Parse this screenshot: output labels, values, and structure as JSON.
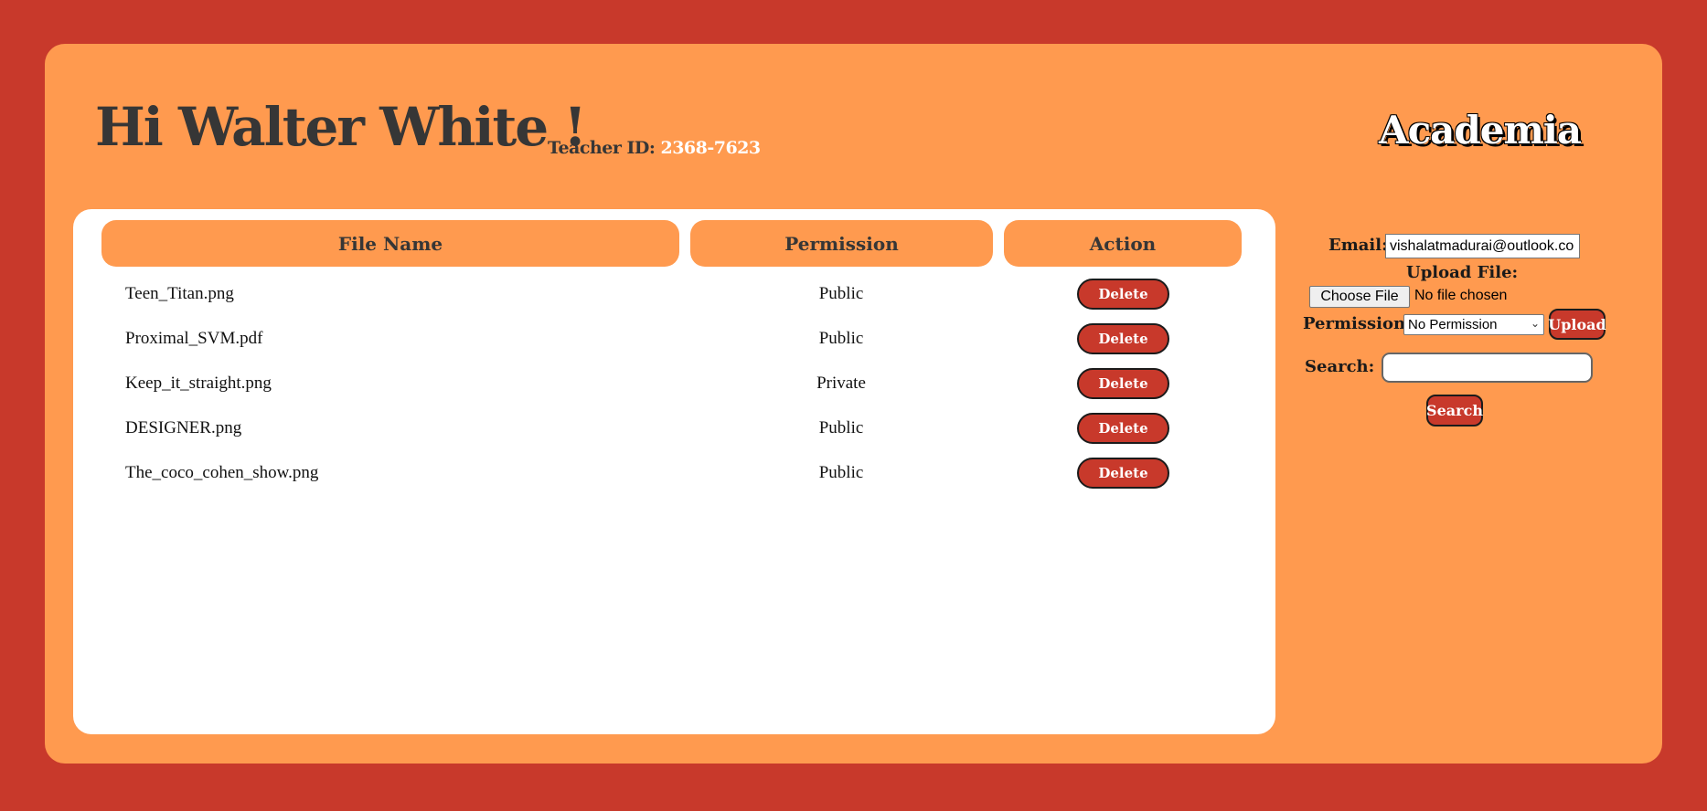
{
  "header": {
    "greeting": "Hi Walter White !",
    "teacher_label": "Teacher ID:",
    "teacher_id": "2368-7623",
    "brand": "Academia"
  },
  "table": {
    "columns": [
      "File Name",
      "Permission",
      "Action"
    ],
    "rows": [
      {
        "file_name": "Teen_Titan.png",
        "permission": "Public",
        "action": "Delete"
      },
      {
        "file_name": "Proximal_SVM.pdf",
        "permission": "Public",
        "action": "Delete"
      },
      {
        "file_name": "Keep_it_straight.png",
        "permission": "Private",
        "action": "Delete"
      },
      {
        "file_name": "DESIGNER.png",
        "permission": "Public",
        "action": "Delete"
      },
      {
        "file_name": "The_coco_cohen_show.png",
        "permission": "Public",
        "action": "Delete"
      }
    ]
  },
  "form": {
    "email_label": "Email:",
    "email_value": "vishalatmadurai@outlook.co",
    "upload_label": "Upload File:",
    "choose_file_label": "Choose File",
    "no_file_text": "No file chosen",
    "permission_label": "Permission:",
    "permission_selected": "No Permission",
    "upload_button": "Upload",
    "search_label": "Search:",
    "search_value": "",
    "search_button": "Search"
  },
  "colors": {
    "background": "#c8392b",
    "frame": "#ff9a4f",
    "panel": "#ffffff",
    "button": "#c8392b",
    "heading_text": "#363636"
  },
  "icons": {
    "select_chevron": "chevron-down-icon"
  }
}
